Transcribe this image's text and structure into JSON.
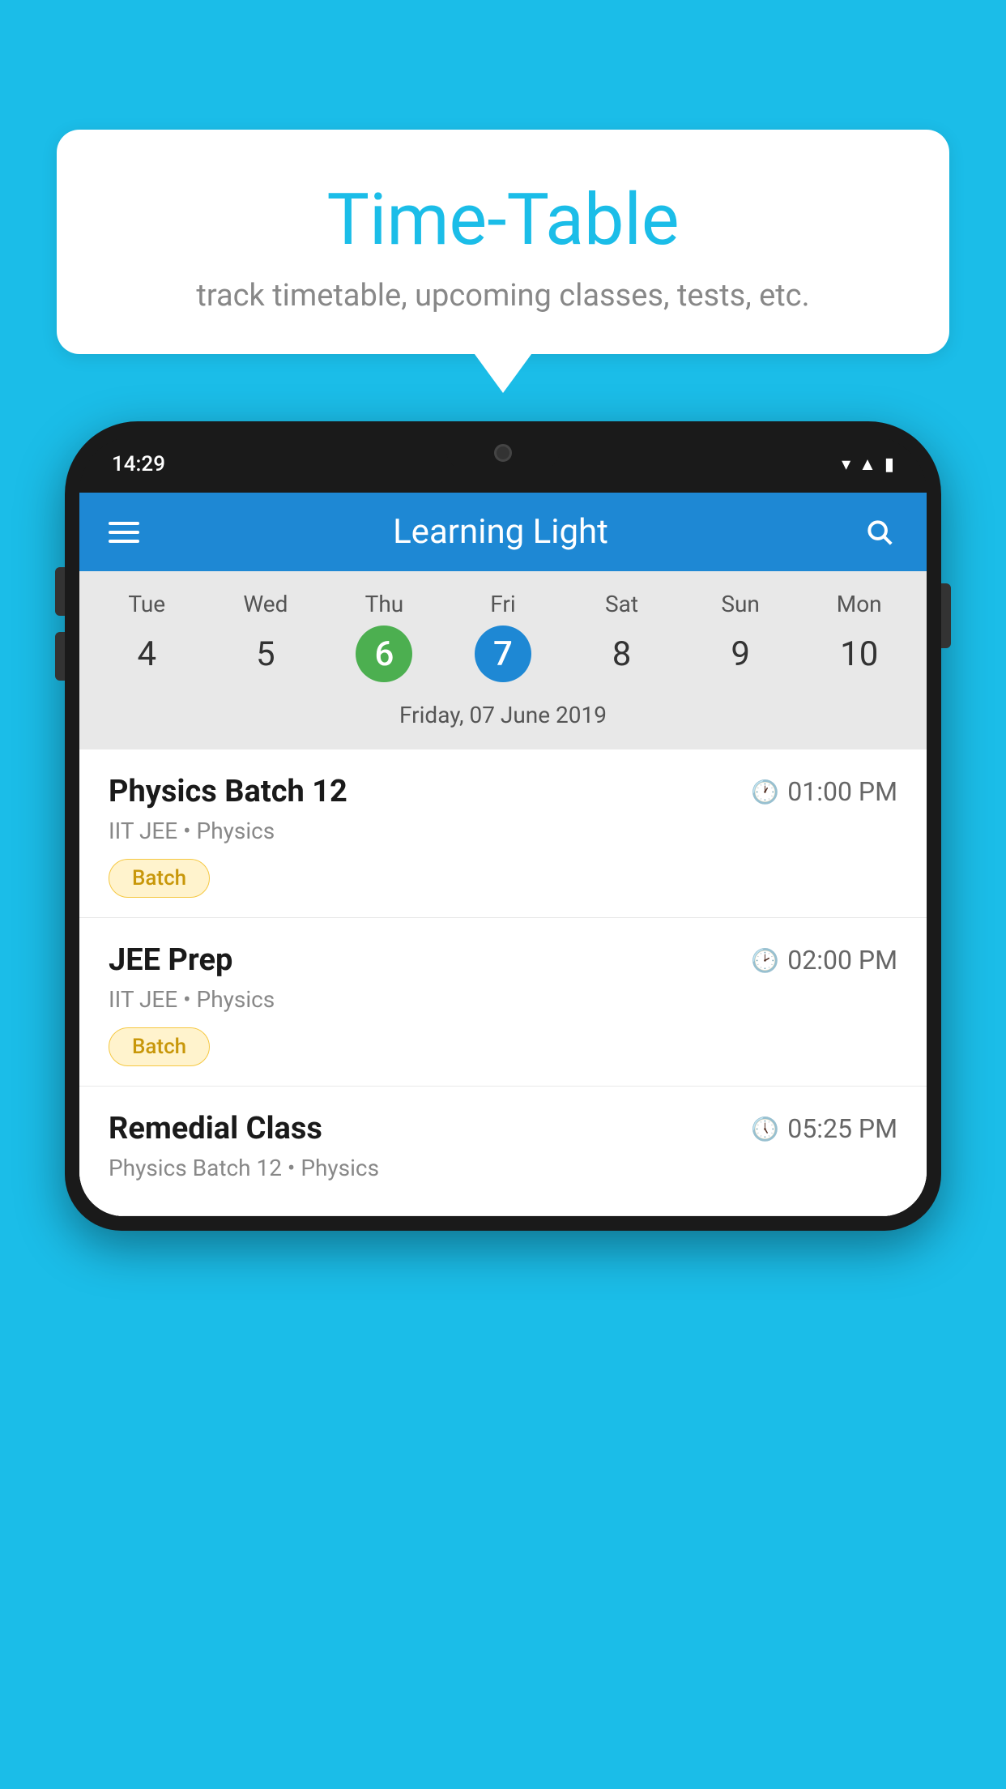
{
  "background_color": "#1BBDE8",
  "speech_bubble": {
    "title": "Time-Table",
    "subtitle": "track timetable, upcoming classes, tests, etc."
  },
  "phone": {
    "status_bar": {
      "time": "14:29"
    },
    "app_header": {
      "title": "Learning Light"
    },
    "calendar": {
      "days": [
        {
          "label": "Tue",
          "num": "4"
        },
        {
          "label": "Wed",
          "num": "5"
        },
        {
          "label": "Thu",
          "num": "6",
          "style": "today-green"
        },
        {
          "label": "Fri",
          "num": "7",
          "style": "selected-blue"
        },
        {
          "label": "Sat",
          "num": "8"
        },
        {
          "label": "Sun",
          "num": "9"
        },
        {
          "label": "Mon",
          "num": "10"
        }
      ],
      "selected_date_label": "Friday, 07 June 2019"
    },
    "schedule": [
      {
        "title": "Physics Batch 12",
        "time": "01:00 PM",
        "subtitle": "IIT JEE • Physics",
        "badge": "Batch"
      },
      {
        "title": "JEE Prep",
        "time": "02:00 PM",
        "subtitle": "IIT JEE • Physics",
        "badge": "Batch"
      },
      {
        "title": "Remedial Class",
        "time": "05:25 PM",
        "subtitle": "Physics Batch 12 • Physics",
        "badge": ""
      }
    ]
  }
}
